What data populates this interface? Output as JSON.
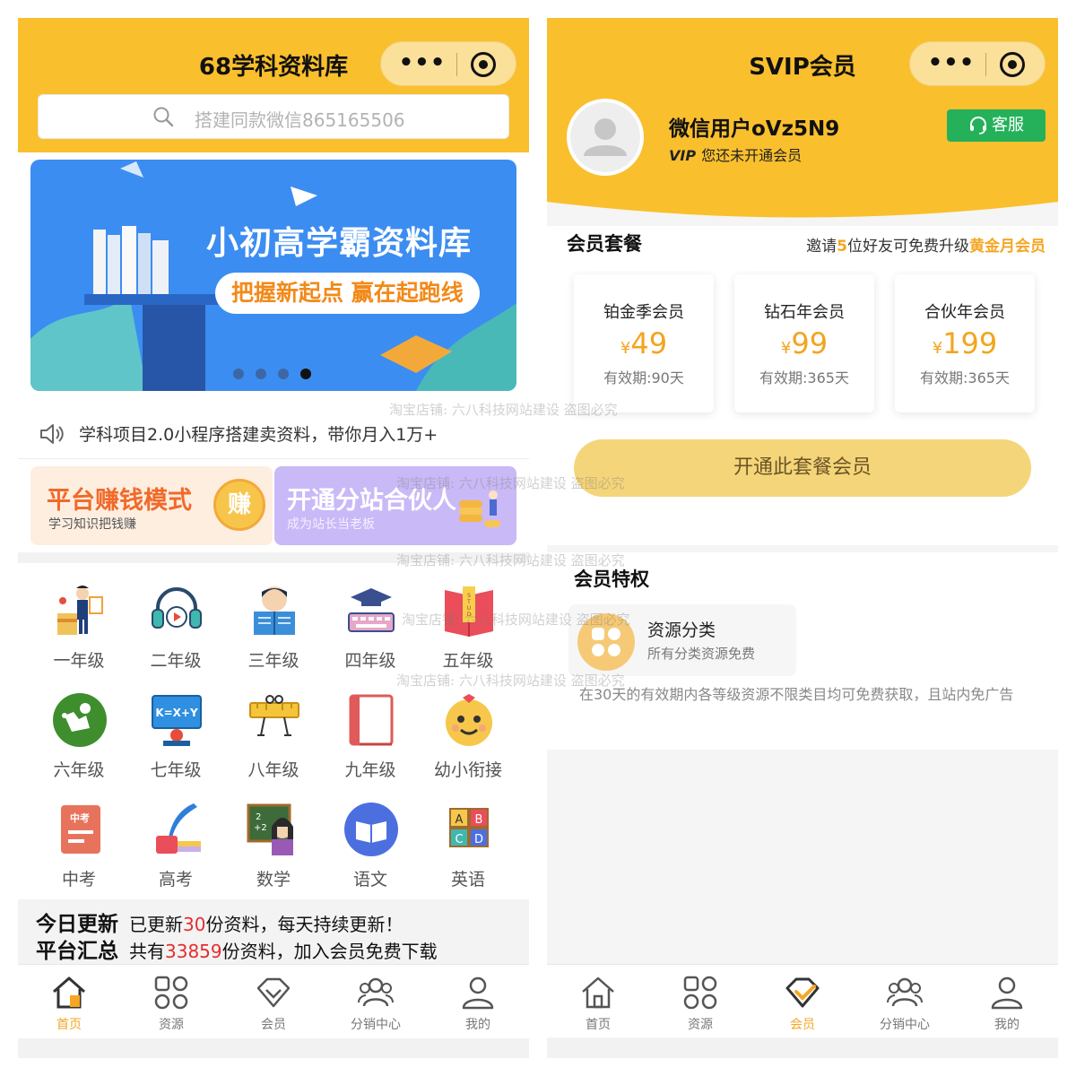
{
  "left": {
    "title": "68学科资料库",
    "search": {
      "placeholder": "搭建同款微信865165506"
    },
    "banner": {
      "headline": "小初高学霸资料库",
      "slogan": "把握新起点 赢在起跑线",
      "active_dot": 4,
      "dot_count": 4
    },
    "notice": "学科项目2.0小程序搭建卖资料，带你月入1万+",
    "promos": [
      {
        "title": "平台赚钱模式",
        "subtitle": "学习知识把钱赚",
        "badge": "赚"
      },
      {
        "title": "开通分站合伙人",
        "subtitle": "成为站长当老板"
      }
    ],
    "grades": [
      {
        "label": "一年级",
        "icon": "teacher-icon"
      },
      {
        "label": "二年级",
        "icon": "headphones-icon"
      },
      {
        "label": "三年级",
        "icon": "student-reading-icon"
      },
      {
        "label": "四年级",
        "icon": "graduation-keyboard-icon"
      },
      {
        "label": "五年级",
        "icon": "study-book-icon"
      },
      {
        "label": "六年级",
        "icon": "student-green-icon"
      },
      {
        "label": "七年级",
        "icon": "math-board-icon"
      },
      {
        "label": "八年级",
        "icon": "ruler-character-icon"
      },
      {
        "label": "九年级",
        "icon": "notebook-icon"
      },
      {
        "label": "幼小衔接",
        "icon": "baby-face-icon"
      },
      {
        "label": "中考",
        "icon": "exam-paper-icon"
      },
      {
        "label": "高考",
        "icon": "quill-ink-icon"
      },
      {
        "label": "数学",
        "icon": "math-teacher-icon"
      },
      {
        "label": "语文",
        "icon": "open-book-icon"
      },
      {
        "label": "英语",
        "icon": "abcd-blocks-icon"
      }
    ],
    "stats": {
      "today_label": "今日更新",
      "today_pre": "已更新",
      "today_num": "30",
      "today_post": "份资料，每天持续更新！",
      "total_label": "平台汇总",
      "total_pre": "共有",
      "total_num": "33859",
      "total_post": "份资料，加入会员免费下载"
    },
    "tabs": [
      {
        "label": "首页",
        "icon": "home-icon",
        "active": true
      },
      {
        "label": "资源",
        "icon": "grid-icon",
        "active": false
      },
      {
        "label": "会员",
        "icon": "diamond-icon",
        "active": false
      },
      {
        "label": "分销中心",
        "icon": "users-icon",
        "active": false
      },
      {
        "label": "我的",
        "icon": "user-icon",
        "active": false
      }
    ]
  },
  "right": {
    "title": "SVIP会员",
    "user": {
      "name": "微信用户oVz5N9",
      "vip_mark": "VIP",
      "status": "您还未开通会员"
    },
    "service_label": "客服",
    "packages": {
      "title": "会员套餐",
      "invite_pre": "邀请",
      "invite_num": "5",
      "invite_mid": "位好友可免费升级",
      "invite_target": "黄金月会员",
      "items": [
        {
          "name": "铂金季会员",
          "currency": "¥",
          "price": "49",
          "validity": "有效期:90天"
        },
        {
          "name": "钻石年会员",
          "currency": "¥",
          "price": "99",
          "validity": "有效期:365天"
        },
        {
          "name": "合伙年会员",
          "currency": "¥",
          "price": "199",
          "validity": "有效期:365天"
        }
      ],
      "open_button": "开通此套餐会员"
    },
    "privileges": {
      "title": "会员特权",
      "item_name": "资源分类",
      "item_desc": "所有分类资源免费",
      "note": "在30天的有效期内各等级资源不限类目均可免费获取，且站内免广告"
    },
    "tabs": [
      {
        "label": "首页",
        "icon": "home-icon",
        "active": false
      },
      {
        "label": "资源",
        "icon": "grid-icon",
        "active": false
      },
      {
        "label": "会员",
        "icon": "diamond-icon",
        "active": true
      },
      {
        "label": "分销中心",
        "icon": "users-icon",
        "active": false
      },
      {
        "label": "我的",
        "icon": "user-icon",
        "active": false
      }
    ]
  },
  "watermark": "淘宝店铺: 六八科技网站建设 盗图必究",
  "colors": {
    "header": "#f9bf2d",
    "accent": "#f5a623",
    "price": "#f2a51f",
    "highlight_red": "#e52e2e",
    "service_green": "#25b15a"
  }
}
